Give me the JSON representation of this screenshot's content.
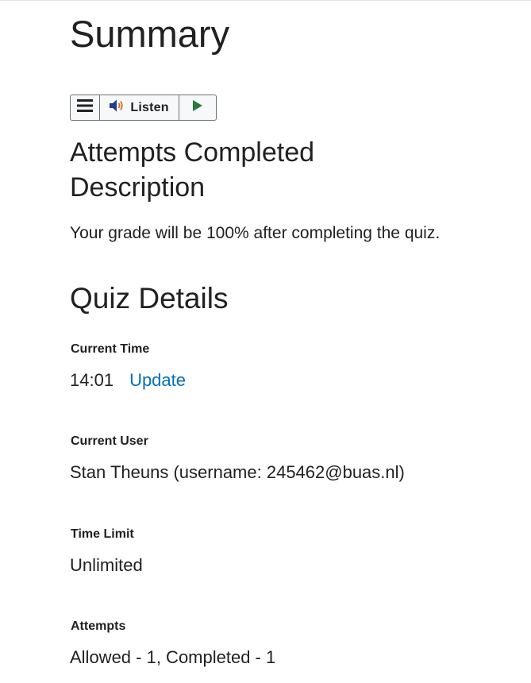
{
  "page": {
    "title": "Summary"
  },
  "listen_toolbar": {
    "menu_icon": "hamburger-menu-icon",
    "speaker_icon": "speaker-icon",
    "listen_label": "Listen",
    "play_icon": "play-icon",
    "play_color": "#2a7a3b"
  },
  "attempts_section": {
    "heading": "Attempts Completed Description",
    "description": "Your grade will be 100% after completing the quiz."
  },
  "quiz_details": {
    "heading": "Quiz Details",
    "current_time": {
      "label": "Current Time",
      "value": "14:01",
      "update_link": "Update"
    },
    "current_user": {
      "label": "Current User",
      "value": "Stan Theuns (username: 245462@buas.nl)"
    },
    "time_limit": {
      "label": "Time Limit",
      "value": "Unlimited"
    },
    "attempts": {
      "label": "Attempts",
      "value": "Allowed - 1, Completed - 1"
    }
  },
  "colors": {
    "link": "#006fbf",
    "text": "#202122",
    "toolbar_border": "#6e7376"
  }
}
